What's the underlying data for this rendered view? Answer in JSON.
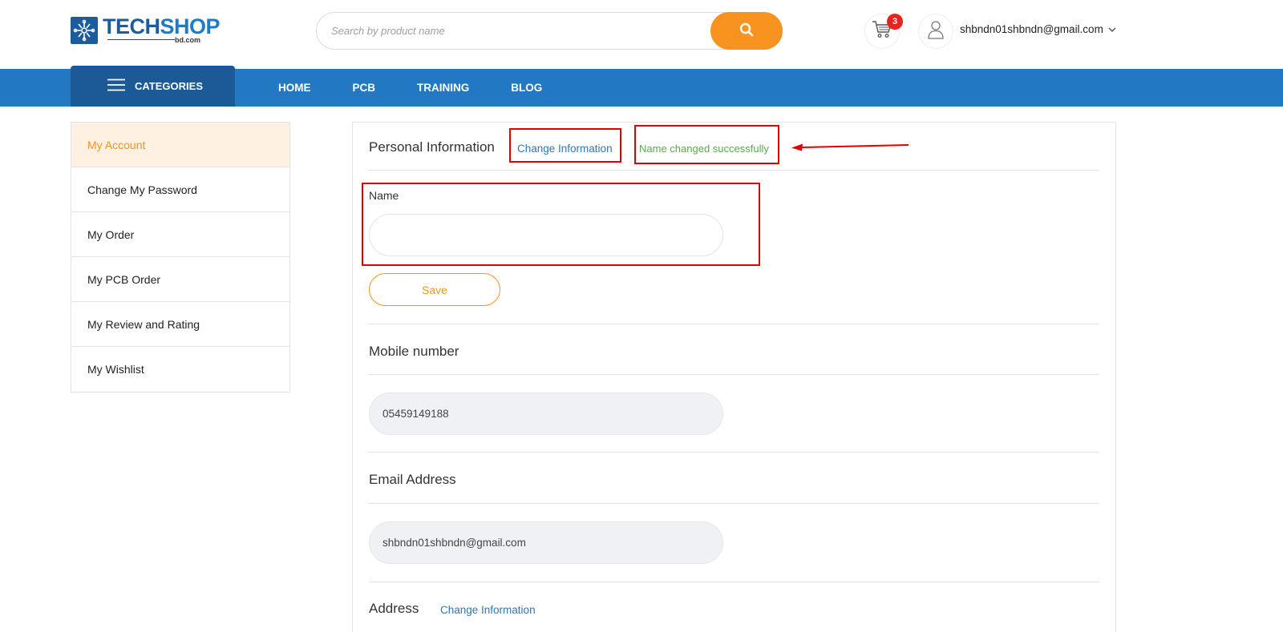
{
  "header": {
    "logo": {
      "brand_tech": "TECH",
      "brand_shop": "SHOP",
      "domain": "bd.com"
    },
    "search": {
      "placeholder": "Search by product name"
    },
    "cart": {
      "count": "3"
    },
    "user": {
      "email": "shbndn01shbndn@gmail.com"
    }
  },
  "nav": {
    "categories_label": "CATEGORIES",
    "links": [
      "HOME",
      "PCB",
      "TRAINING",
      "BLOG"
    ]
  },
  "sidebar": {
    "items": [
      {
        "label": "My Account",
        "active": true
      },
      {
        "label": "Change My Password",
        "active": false
      },
      {
        "label": "My Order",
        "active": false
      },
      {
        "label": "My PCB Order",
        "active": false
      },
      {
        "label": "My Review and Rating",
        "active": false
      },
      {
        "label": "My Wishlist",
        "active": false
      }
    ]
  },
  "main": {
    "personal": {
      "title": "Personal Information",
      "change_link": "Change Information",
      "success_message": "Name changed successfully",
      "name_label": "Name",
      "name_value": "",
      "save_label": "Save"
    },
    "mobile": {
      "title": "Mobile number",
      "value": "05459149188"
    },
    "email": {
      "title": "Email Address",
      "value": "shbndn01shbndn@gmail.com"
    },
    "address": {
      "title": "Address",
      "change_link": "Change Information"
    }
  },
  "colors": {
    "primary_blue": "#2378c3",
    "dark_blue": "#1b5a97",
    "accent_orange": "#f7931e",
    "success_green": "#5aa84a",
    "annotation_red": "#e00000"
  },
  "icons": [
    "logo-chip-icon",
    "search-icon",
    "cart-icon",
    "user-icon",
    "chevron-down-icon",
    "hamburger-icon"
  ]
}
